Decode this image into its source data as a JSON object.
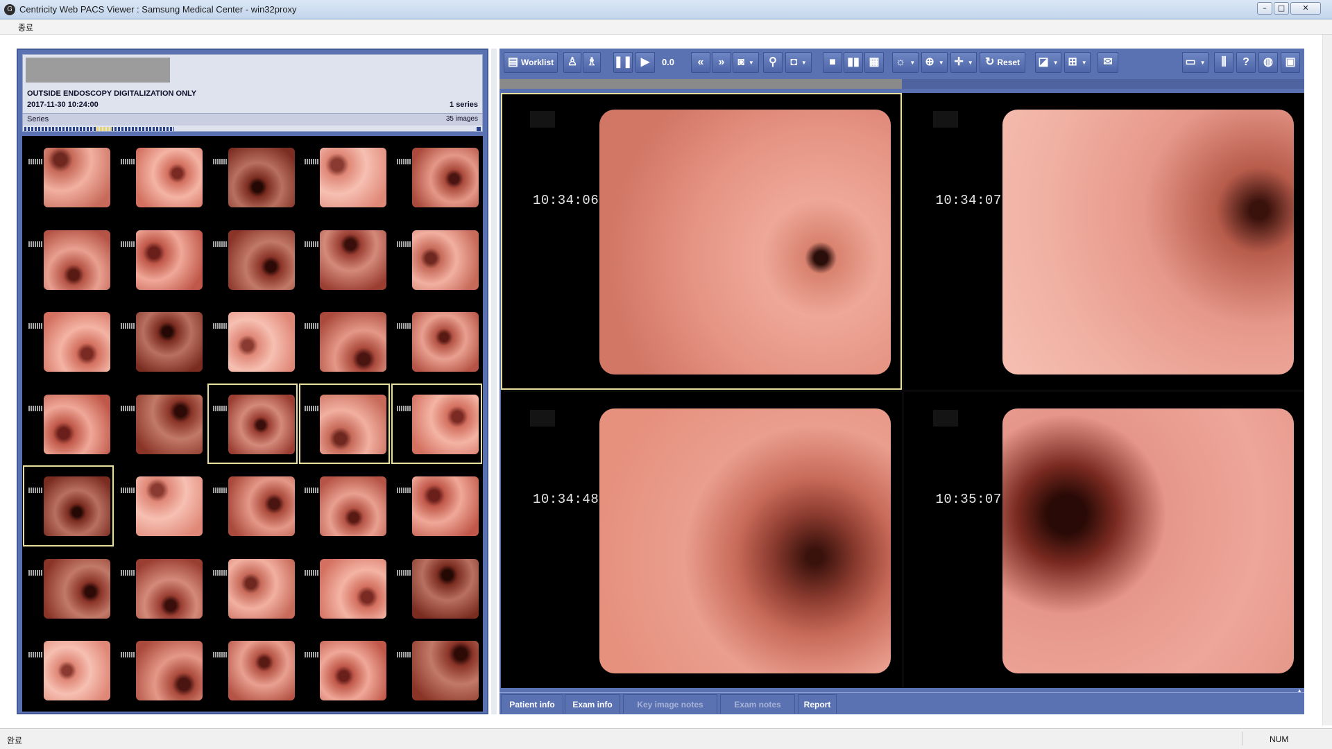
{
  "window": {
    "title": "Centricity Web PACS Viewer : Samsung Medical Center - win32proxy",
    "menu_label": "종료",
    "status_left": "완료",
    "status_num": "NUM"
  },
  "study": {
    "description": "OUTSIDE ENDOSCOPY DIGITALIZATION ONLY",
    "datetime": "2017-11-30 10:24:00",
    "series_count": "1 series",
    "series_label": "Series",
    "images_count": "35 images",
    "thumbnail_count": 35,
    "selected_thumbnails": [
      17,
      18,
      19,
      20
    ]
  },
  "toolbar": {
    "worklist_label": "Worklist",
    "zoom_value": "0.0",
    "reset_label": "Reset"
  },
  "viewports": [
    {
      "timestamp": "10:34:06",
      "active": true
    },
    {
      "timestamp": "10:34:07",
      "active": false
    },
    {
      "timestamp": "10:34:48",
      "active": false
    },
    {
      "timestamp": "10:35:07",
      "active": false
    }
  ],
  "bottom_tabs": [
    {
      "label": "Patient info",
      "enabled": true
    },
    {
      "label": "Exam info",
      "enabled": true
    },
    {
      "label": "Key image notes",
      "enabled": false
    },
    {
      "label": "Exam notes",
      "enabled": false
    },
    {
      "label": "Report",
      "enabled": true
    }
  ],
  "colors": {
    "panel_blue": "#5a72b2",
    "selection_yellow": "#e9e0a0",
    "tissue_pink": "#e08a7a"
  }
}
